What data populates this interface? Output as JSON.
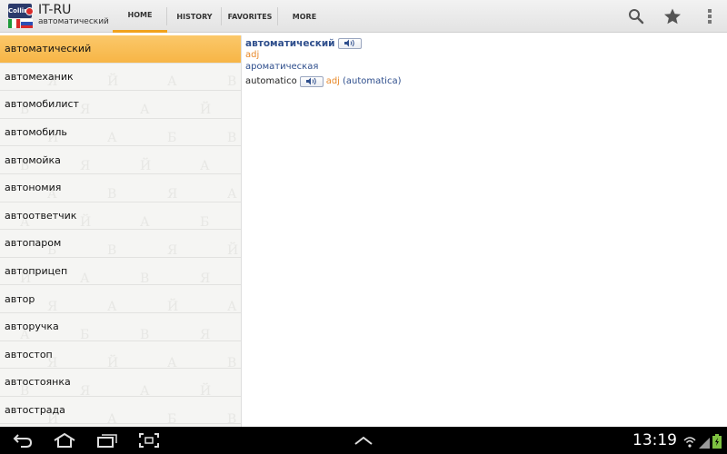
{
  "app": {
    "title": "IT-RU",
    "subtitle": "автоматический",
    "icon_text": "Collins"
  },
  "tabs": [
    {
      "label": "HOME",
      "active": true
    },
    {
      "label": "HISTORY",
      "active": false
    },
    {
      "label": "FAVORITES",
      "active": false
    },
    {
      "label": "MORE",
      "active": false
    }
  ],
  "actions": {
    "search_icon": "search-icon",
    "favorite_icon": "star-icon",
    "overflow_icon": "overflow-menu-icon"
  },
  "word_list": {
    "selected_index": 0,
    "items": [
      "автоматический",
      "автомеханик",
      "автомобилист",
      "автомобиль",
      "автомойка",
      "автономия",
      "автоответчик",
      "автопаром",
      "автоприцеп",
      "автор",
      "авторучка",
      "автостоп",
      "автостоянка",
      "автострада"
    ]
  },
  "entry": {
    "headword": "автоматический",
    "pos": "adj",
    "sense": "ароматическая",
    "translation": {
      "word": "automatico",
      "pos": "adj",
      "alt": "(automatica)"
    }
  },
  "status_bar": {
    "time": "13:19"
  },
  "colors": {
    "accent": "#f1a21c",
    "selected_item": "#f7b546",
    "headword": "#2e4e8c",
    "pos": "#e8892a"
  }
}
